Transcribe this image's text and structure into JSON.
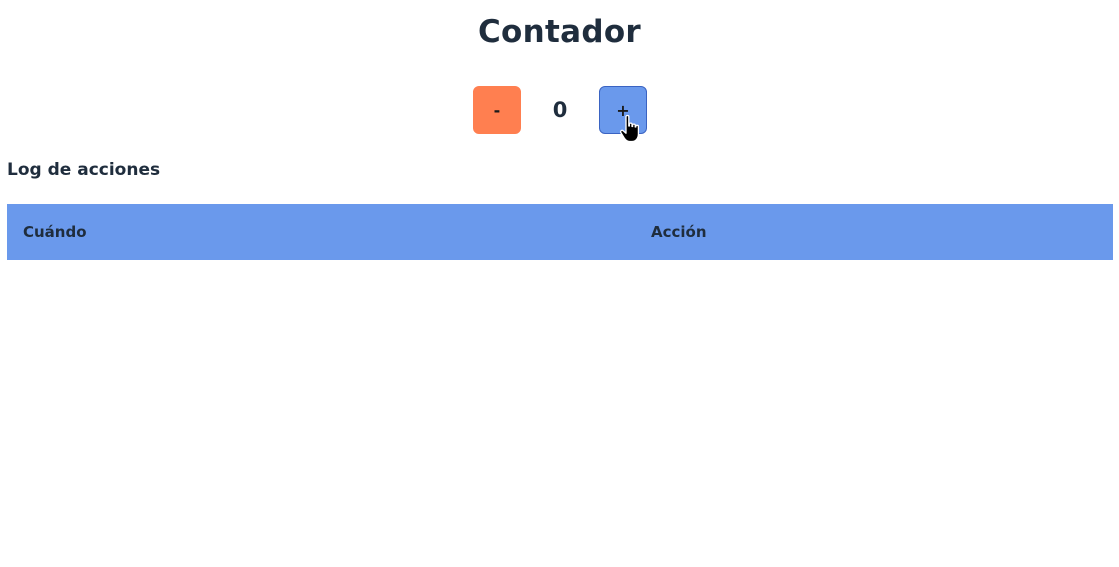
{
  "page": {
    "title": "Contador"
  },
  "counter": {
    "decrement_label": "-",
    "value": "0",
    "increment_label": "+"
  },
  "log": {
    "title": "Log de acciones",
    "columns": [
      "Cuándo",
      "Acción"
    ],
    "rows": []
  },
  "colors": {
    "decrement_button": "#ff7f50",
    "increment_button": "#6a99ec",
    "table_header": "#6a99ec",
    "text": "#1f2d3d"
  },
  "icons": {
    "cursor": "hand-pointer-icon"
  }
}
